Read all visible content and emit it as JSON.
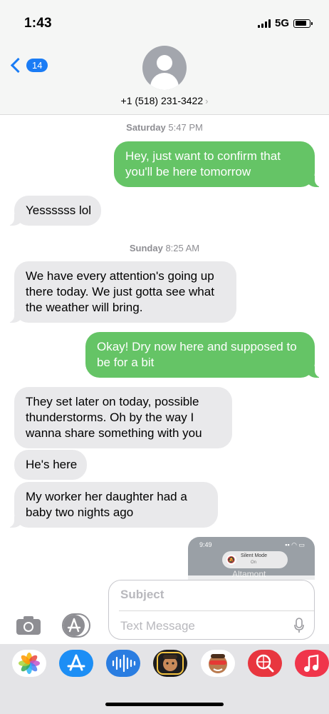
{
  "status": {
    "time": "1:43",
    "network": "5G"
  },
  "header": {
    "back_count": "14",
    "contact": "+1 (518) 231-3422",
    "chevron": "›"
  },
  "messages": [
    {
      "type": "timestamp",
      "day": "Saturday",
      "time": "5:47 PM"
    },
    {
      "type": "sent",
      "text": "Hey, just want to confirm that you'll be here tomorrow"
    },
    {
      "type": "received",
      "text": "Yessssss lol"
    },
    {
      "type": "timestamp",
      "day": "Sunday",
      "time": "8:25 AM"
    },
    {
      "type": "received",
      "text": "We have every attention's going up there today. We just gotta see what the weather will bring."
    },
    {
      "type": "sent",
      "text": "Okay! Dry now here and supposed to be for a bit"
    },
    {
      "type": "received",
      "text": "They set later on today, possible thunderstorms. Oh by the way I wanna share something with you"
    },
    {
      "type": "received",
      "text": "He's here"
    },
    {
      "type": "received",
      "text": "My worker her daughter had a baby two nights ago"
    }
  ],
  "screenshot_thumb": {
    "time": "9:49",
    "pill_title": "Silent Mode",
    "pill_sub": "On",
    "place": "Altamont"
  },
  "compose": {
    "subject_placeholder": "Subject",
    "message_placeholder": "Text Message"
  },
  "app_drawer": [
    "photos-icon",
    "app-store-icon",
    "audio-message-icon",
    "memoji-icon",
    "animoji-icon",
    "web-search-icon",
    "music-icon"
  ],
  "colors": {
    "sent": "#65c466",
    "received": "#e9e9eb",
    "accent": "#1a7cf5"
  }
}
